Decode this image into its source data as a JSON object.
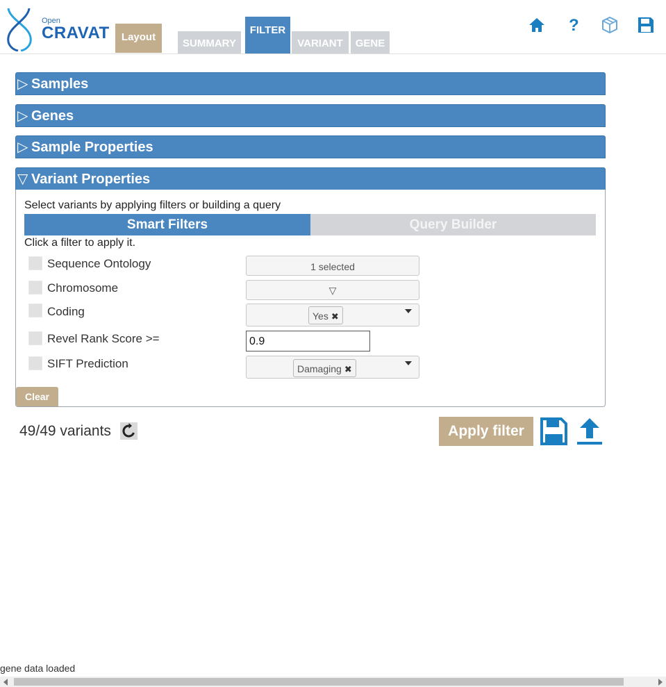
{
  "header": {
    "logo": {
      "open": "Open",
      "cravat": "CRAVAT"
    },
    "tabs": {
      "layout": "Layout",
      "summary": "SUMMARY",
      "filter": "FILTER",
      "variant": "VARIANT",
      "gene": "GENE"
    },
    "icons": [
      "home-icon",
      "help-icon",
      "package-icon",
      "save-icon"
    ]
  },
  "sections": {
    "samples": "Samples",
    "genes": "Genes",
    "sample_properties": "Sample Properties",
    "variant_properties": "Variant Properties"
  },
  "variant_properties": {
    "intro": "Select variants by applying filters or building a query",
    "tabs": {
      "smart": "Smart Filters",
      "query_builder": "Query Builder"
    },
    "hint": "Click a filter to apply it.",
    "filters": [
      {
        "label": "Sequence Ontology",
        "value": "1 selected"
      },
      {
        "label": "Chromosome",
        "value": "▽"
      },
      {
        "label": "Coding",
        "value": "Yes"
      },
      {
        "label": "Revel Rank Score >=",
        "value": "0.9"
      },
      {
        "label": "SIFT Prediction",
        "value": "Damaging"
      }
    ],
    "clear": "Clear"
  },
  "footer": {
    "count": "49/49 variants",
    "apply": "Apply filter",
    "status": "gene data loaded"
  },
  "colors": {
    "accent": "#4a86c0",
    "tan": "#c2ad8d",
    "inactive_tab": "#cfd2d6",
    "icon_blue": "#1a7fc1"
  }
}
